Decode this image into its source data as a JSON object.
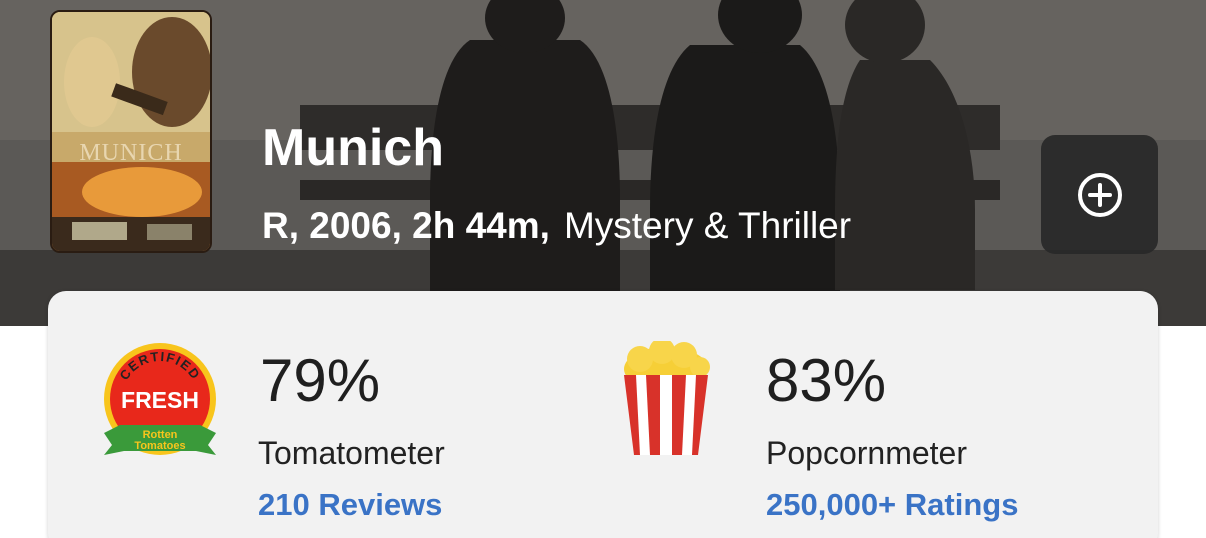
{
  "movie": {
    "title": "Munich",
    "poster_title": "MUNICH",
    "rating_year_runtime": "R, 2006, 2h 44m,",
    "genre": "Mystery & Thriller"
  },
  "tomatometer": {
    "badge_top": "CERTIFIED",
    "badge_main": "FRESH",
    "badge_brand_1": "Rotten",
    "badge_brand_2": "Tomatoes",
    "value": "79%",
    "label": "Tomatometer",
    "reviews_link": "210 Reviews",
    "icon": "certified-fresh-icon"
  },
  "popcornmeter": {
    "value": "83%",
    "label": "Popcornmeter",
    "ratings_link": "250,000+ Ratings",
    "icon": "popcorn-icon"
  },
  "actions": {
    "add_icon": "plus-circle-icon"
  },
  "colors": {
    "link": "#3a73c6",
    "fresh_red": "#e8281b",
    "badge_yellow": "#f8c51c",
    "badge_green": "#3a9a3a",
    "card_bg": "#f2f2f2"
  }
}
